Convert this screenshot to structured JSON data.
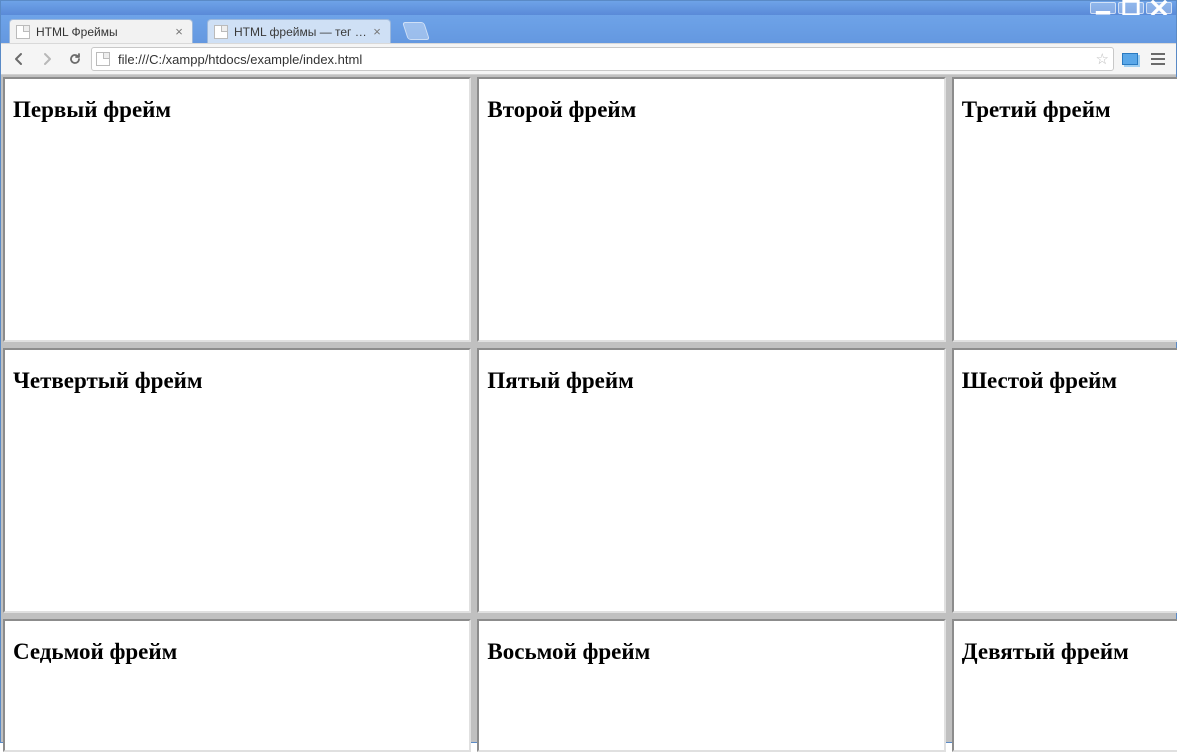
{
  "window": {
    "controls": {
      "min": "min",
      "max": "max",
      "close": "close"
    }
  },
  "tabs": [
    {
      "title": "HTML Фреймы",
      "active": true
    },
    {
      "title": "HTML фреймы — тег fram",
      "active": false
    }
  ],
  "toolbar": {
    "url": "file:///C:/xampp/htdocs/example/index.html"
  },
  "frames": [
    "Первый фрейм",
    "Второй фрейм",
    "Третий фрейм",
    "Четвертый фрейм",
    "Пятый фрейм",
    "Шестой фрейм",
    "Седьмой фрейм",
    "Восьмой фрейм",
    "Девятый фрейм"
  ]
}
